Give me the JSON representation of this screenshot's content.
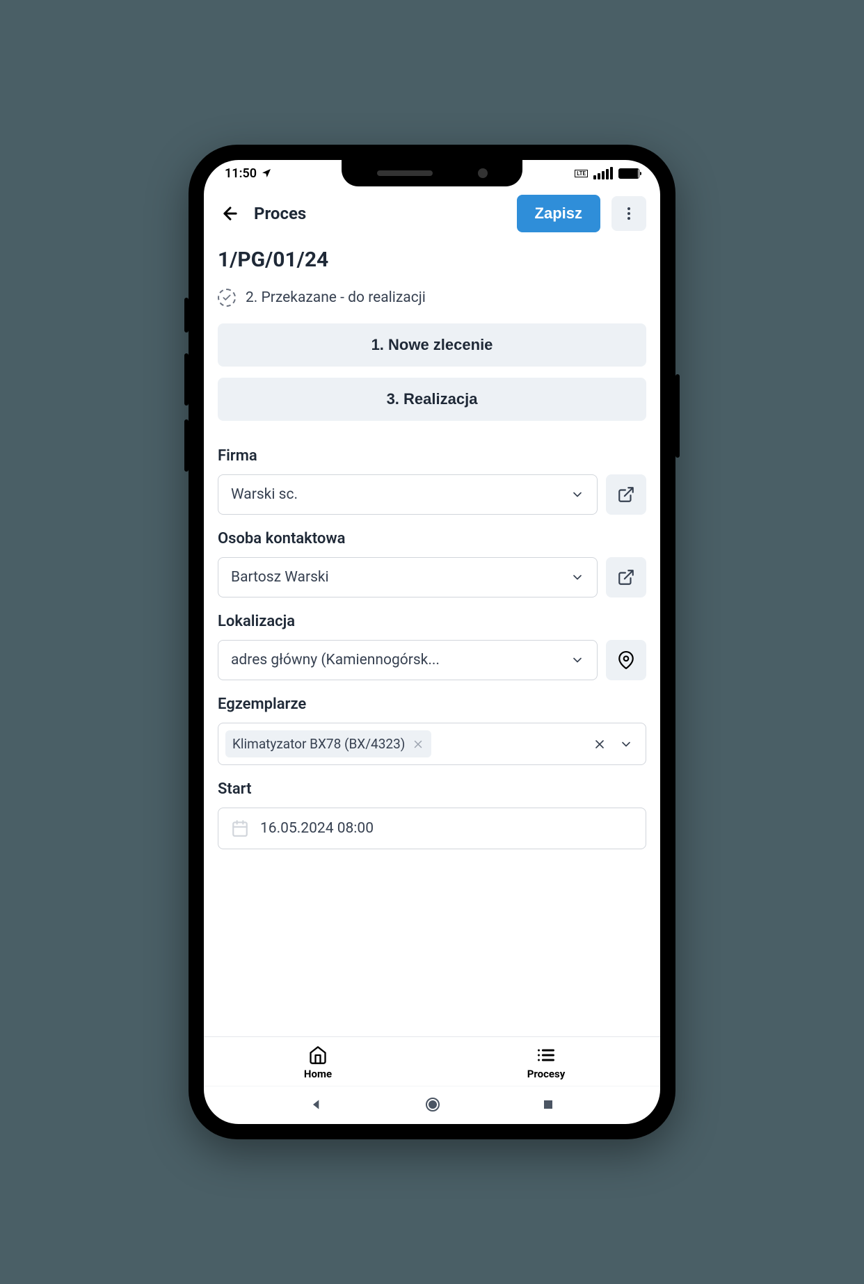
{
  "statusBar": {
    "time": "11:50"
  },
  "header": {
    "title": "Proces",
    "saveLabel": "Zapisz"
  },
  "docNumber": "1/PG/01/24",
  "statusText": "2. Przekazane - do realizacji",
  "stages": {
    "stage1": "1. Nowe zlecenie",
    "stage3": "3. Realizacja"
  },
  "form": {
    "company": {
      "label": "Firma",
      "value": "Warski sc."
    },
    "contact": {
      "label": "Osoba kontaktowa",
      "value": "Bartosz Warski"
    },
    "location": {
      "label": "Lokalizacja",
      "value": "adres główny (Kamiennogórsk..."
    },
    "items": {
      "label": "Egzemplarze",
      "tag": "Klimatyzator BX78 (BX/4323)"
    },
    "start": {
      "label": "Start",
      "value": "16.05.2024 08:00"
    }
  },
  "bottomNav": {
    "home": "Home",
    "procesy": "Procesy"
  }
}
